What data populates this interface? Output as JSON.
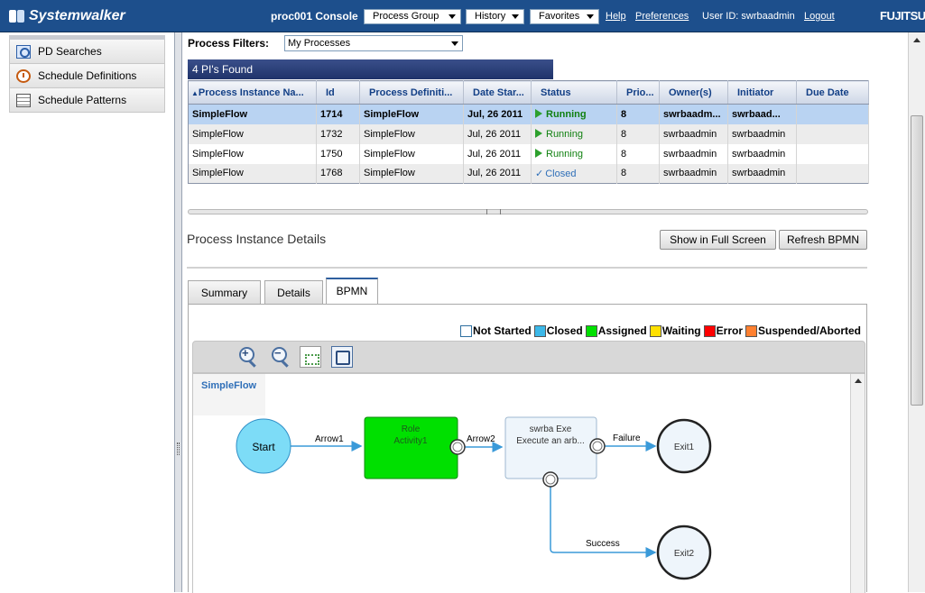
{
  "app": {
    "logo_text": "Systemwalker",
    "console_title": "proc001 Console",
    "vendor": "FUJITSU"
  },
  "topnav": {
    "menus": [
      "Process Group",
      "History",
      "Favorites"
    ],
    "links": [
      "Help",
      "Preferences"
    ],
    "user_id": "User ID: swrbaadmin",
    "logout": "Logout"
  },
  "sidebar": {
    "items": [
      {
        "label": "PD Searches",
        "icon": "search-document-icon"
      },
      {
        "label": "Schedule Definitions",
        "icon": "clock-icon"
      },
      {
        "label": "Schedule Patterns",
        "icon": "calendar-icon"
      }
    ]
  },
  "filters": {
    "label": "Process Filters:",
    "selected": "My Processes"
  },
  "results": {
    "found": "4 PI's Found",
    "columns": [
      "Process Instance Na...",
      "Id",
      "Process Definiti...",
      "Date Star...",
      "Status",
      "Prio...",
      "Owner(s)",
      "Initiator",
      "Due Date"
    ],
    "sort_indicator": "▲",
    "rows": [
      {
        "name": "SimpleFlow",
        "id": "1714",
        "definition": "SimpleFlow",
        "date": "Jul, 26 2011",
        "status": "Running",
        "priority": "8",
        "owner": "swrbaadm...",
        "initiator": "swrbaad...",
        "due": ""
      },
      {
        "name": "SimpleFlow",
        "id": "1732",
        "definition": "SimpleFlow",
        "date": "Jul, 26 2011",
        "status": "Running",
        "priority": "8",
        "owner": "swrbaadmin",
        "initiator": "swrbaadmin",
        "due": ""
      },
      {
        "name": "SimpleFlow",
        "id": "1750",
        "definition": "SimpleFlow",
        "date": "Jul, 26 2011",
        "status": "Running",
        "priority": "8",
        "owner": "swrbaadmin",
        "initiator": "swrbaadmin",
        "due": ""
      },
      {
        "name": "SimpleFlow",
        "id": "1768",
        "definition": "SimpleFlow",
        "date": "Jul, 26 2011",
        "status": "Closed",
        "priority": "8",
        "owner": "swrbaadmin",
        "initiator": "swrbaadmin",
        "due": ""
      }
    ]
  },
  "details": {
    "title": "Process Instance Details",
    "buttons": {
      "full_screen": "Show in Full Screen",
      "refresh": "Refresh BPMN"
    },
    "tabs": [
      "Summary",
      "Details",
      "BPMN"
    ],
    "active_tab": "BPMN"
  },
  "legend": [
    {
      "label": "Not Started",
      "color": "#ffffff"
    },
    {
      "label": "Closed",
      "color": "#3cb8e8"
    },
    {
      "label": "Assigned",
      "color": "#00e000"
    },
    {
      "label": "Waiting",
      "color": "#ffe000"
    },
    {
      "label": "Error",
      "color": "#ff0000"
    },
    {
      "label": "Suspended/Aborted",
      "color": "#ff8030"
    }
  ],
  "bpmn": {
    "flow_name": "SimpleFlow",
    "nodes": {
      "start": "Start",
      "role_activity_line1": "Role",
      "role_activity_line2": "Activity1",
      "exe_line1": "swrba  Exe",
      "exe_line2": "Execute an arb...",
      "exit1": "Exit1",
      "exit2": "Exit2"
    },
    "arrows": {
      "arrow1": "Arrow1",
      "arrow2": "Arrow2",
      "failure": "Failure",
      "success": "Success"
    }
  }
}
